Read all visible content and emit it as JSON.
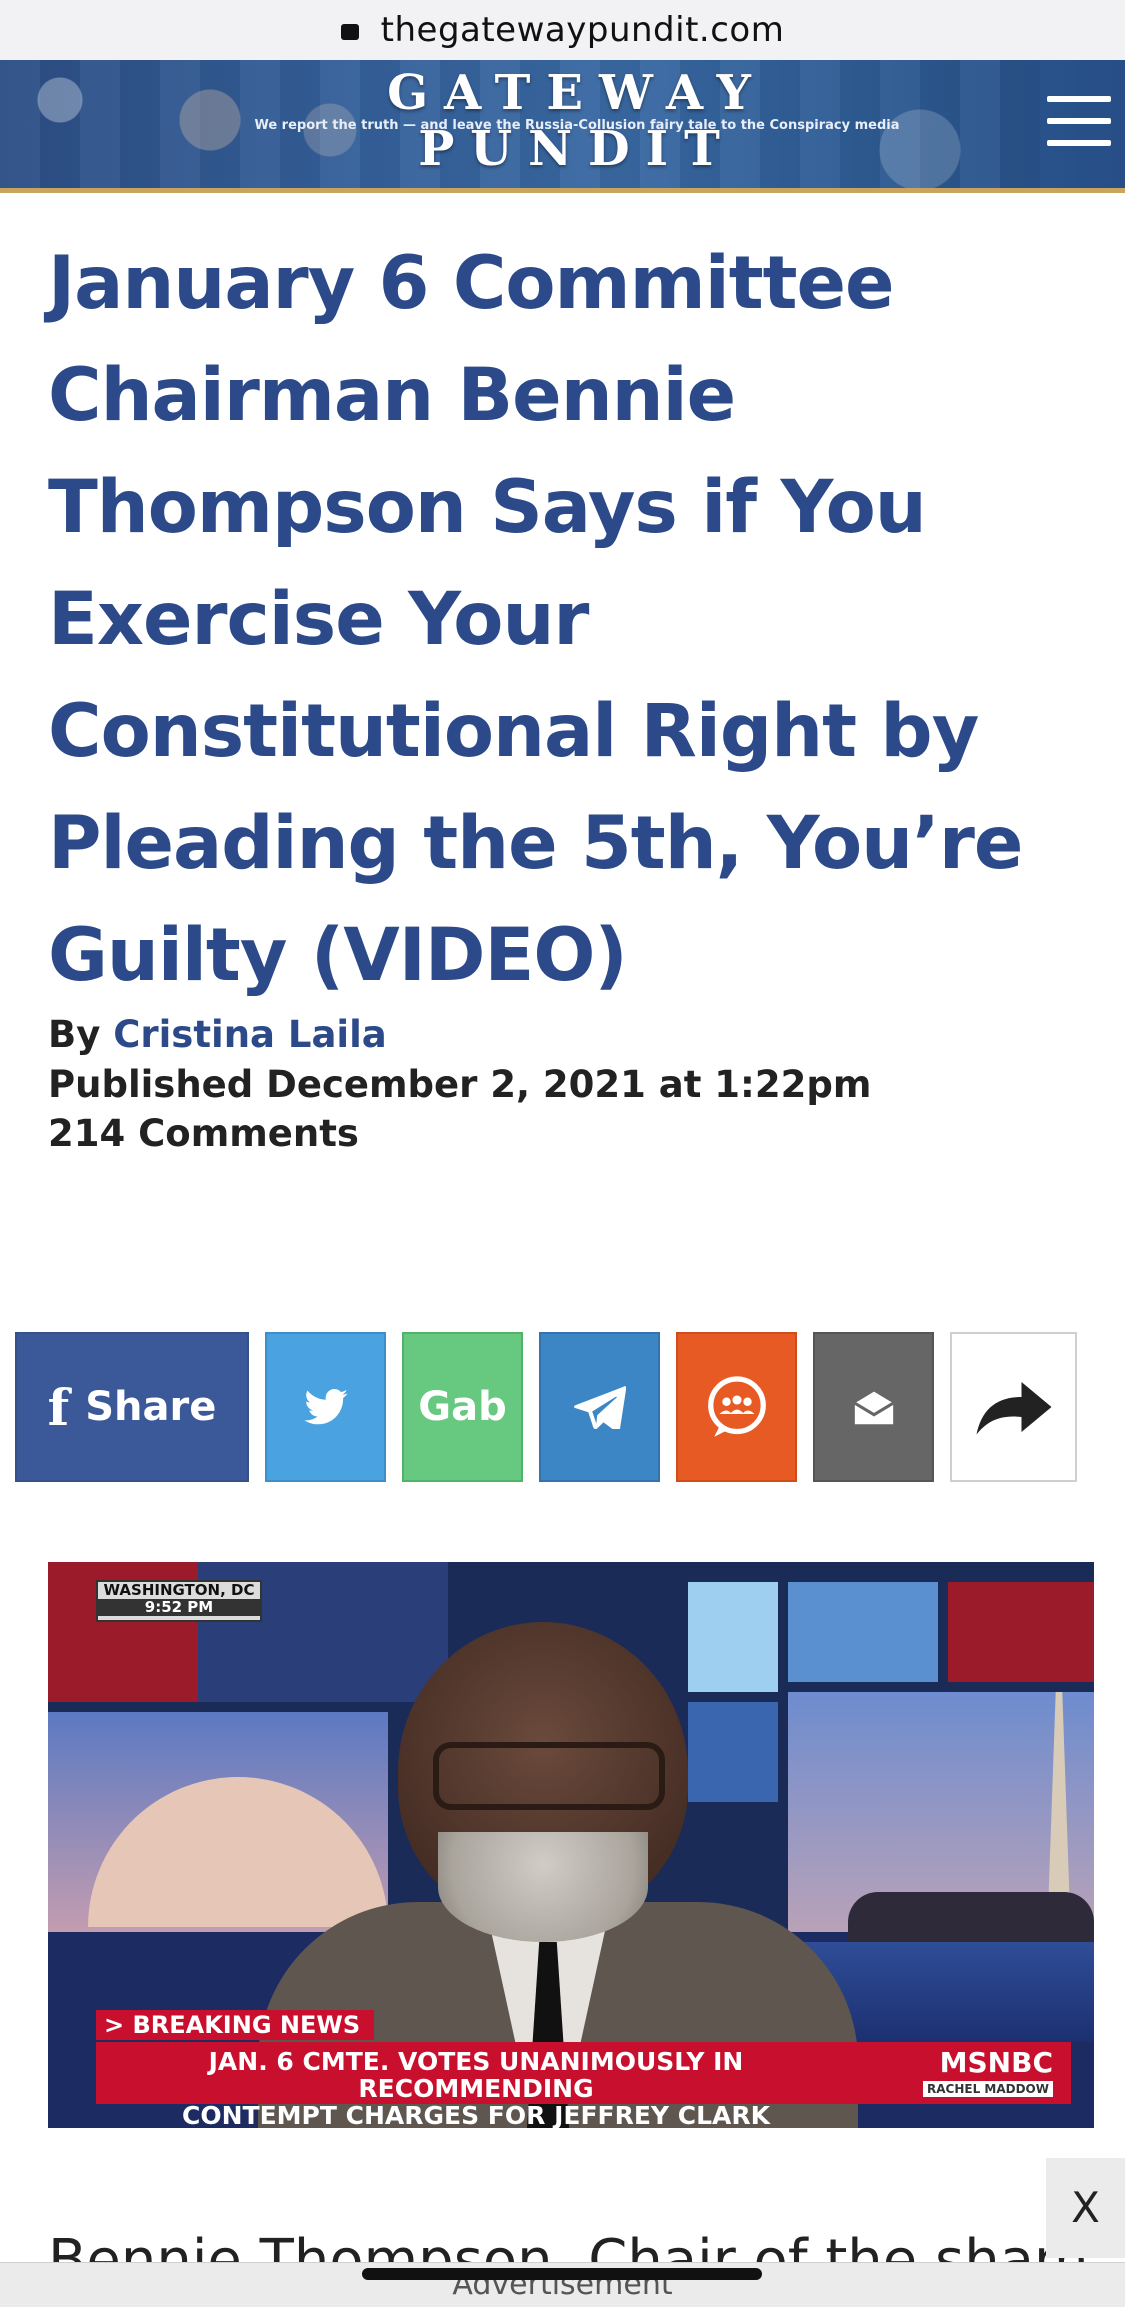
{
  "browser": {
    "url": "thegatewaypundit.com"
  },
  "site": {
    "name": "GATEWAY PUNDIT",
    "tagline": "We report the truth — and leave the Russia-Collusion fairy tale to the Conspiracy media"
  },
  "article": {
    "title": "January 6 Committee Chairman Bennie Thompson Says if You Exercise Your Constitutional Right by Pleading the 5th, You’re Guilty (VIDEO)",
    "by_label": "By",
    "author": "Cristina Laila",
    "published": "Published December 2, 2021 at 1:22pm",
    "comments": "214 Comments",
    "body_start": "Bennie Thompson, Chair of the sham"
  },
  "share": {
    "facebook_label": "Share",
    "gab_label": "Gab"
  },
  "video": {
    "location": "WASHINGTON, DC",
    "time": "9:52 PM",
    "breaking": "> BREAKING NEWS",
    "chyron_line1": "JAN. 6 CMTE. VOTES UNANIMOUSLY IN RECOMMENDING",
    "chyron_line2": "CONTEMPT CHARGES FOR JEFFREY CLARK",
    "network": "MSNBC",
    "show": "RACHEL MADDOW"
  },
  "ad": {
    "label": "Advertisement",
    "close": "X"
  },
  "colors": {
    "title_blue": "#2c4a8a",
    "facebook": "#3b5998",
    "twitter": "#4aa3e0",
    "gab": "#66c97f",
    "telegram": "#3d86c6",
    "chat": "#e85a24",
    "email": "#666666"
  }
}
